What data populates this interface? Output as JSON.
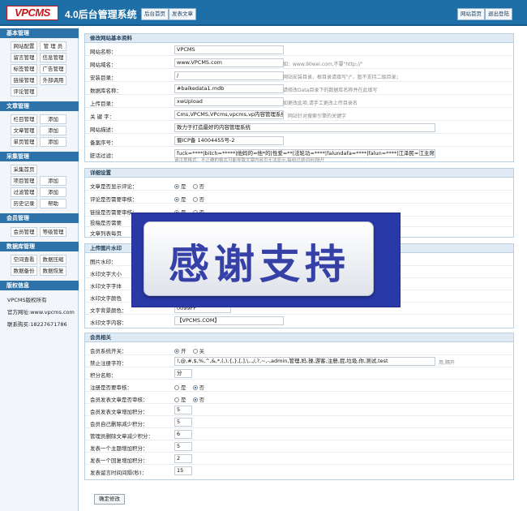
{
  "header": {
    "logo": "VPCMS",
    "title": "4.0后台管理系统",
    "btn_home": "后台首页",
    "btn_post": "发表文章",
    "btn_site_home": "网站首页",
    "btn_logout": "退出登陆"
  },
  "sidebar": {
    "basic": {
      "title": "基本管理",
      "items": [
        "网站配置",
        "管 理 员",
        "留言管理",
        "信息管理",
        "标签管理",
        "广告管理",
        "链接管理",
        "外部调用",
        "评论管理"
      ]
    },
    "article": {
      "title": "文章管理",
      "items": [
        "栏目管理",
        "添加",
        "文章管理",
        "添加",
        "单页管理",
        "添加"
      ]
    },
    "collect": {
      "title": "采集管理",
      "items": [
        "采集首页",
        "项目管理",
        "添加",
        "过滤管理",
        "添加",
        "历史记录",
        "帮助"
      ]
    },
    "member": {
      "title": "会员管理",
      "items": [
        "会员管理",
        "等级管理"
      ]
    },
    "database": {
      "title": "数据库管理",
      "items": [
        "空间查看",
        "数据压缩",
        "数据备份",
        "数据恢复"
      ]
    },
    "copyright": {
      "title": "版权信息",
      "lines": [
        "VPCMS版权所有",
        "官方网址:www.vpcms.com",
        "联系购买:18227671786"
      ]
    }
  },
  "basic_info": {
    "title": "修改网站基本资料",
    "rows": [
      {
        "label": "网站名称：",
        "value": "VPCMS",
        "hint": ""
      },
      {
        "label": "网站域名：",
        "value": "www.VPCMS.com",
        "hint": "如：www.90wei.com,不要\"http://\""
      },
      {
        "label": "安装目录：",
        "value": "/",
        "hint": "网站安装目录，根目录请填写\"/\"，暂不支持二级目录；"
      },
      {
        "label": "数据库名称：",
        "value": "#baikedata1.mdb",
        "hint": "请修改Data目录下的数据库名称并在此填写"
      },
      {
        "label": "上传目录：",
        "value": "xwUpload",
        "hint": "如更改此项,请手工更改上传目录名"
      },
      {
        "label": "关 键 字：",
        "value": "Cms,VPCMS,VPcms,vpcms,vp内容管理系统,最",
        "hint": "网站针对搜索引擎的关键字"
      },
      {
        "label": "网站描述：",
        "value": "致力于打造最好的内容管理系统",
        "hint": ""
      },
      {
        "label": "备案序号：",
        "value": "蜀ICP备 14004455号-2",
        "hint": ""
      },
      {
        "label": "脏话过滤：",
        "value": "fuck=****|bitch=*****|他妈的=他*的|性爱=**|法轮功=****|falundafa=****|falun=****|江泽民=江主席|操你妈=操*",
        "hint": "请注意格式：不正确的格式可能导致文章内容页无法显示,每组过滤词用|隔开"
      }
    ]
  },
  "detail": {
    "title": "详细设置",
    "rows": [
      {
        "label": "文章是否显示评论：",
        "opt1": "是",
        "opt2": "否"
      },
      {
        "label": "评论是否需要审核：",
        "opt1": "是",
        "opt2": "否"
      },
      {
        "label": "链接是否需要审核：",
        "opt1": "是",
        "opt2": "否"
      },
      {
        "label": "投稿是否需要",
        "opt1": "",
        "opt2": ""
      },
      {
        "label": "文章列表每页",
        "opt1": "",
        "opt2": ""
      }
    ]
  },
  "watermark": {
    "title": "上传图片水印",
    "rows": [
      {
        "label": "图片水印：",
        "value": ""
      },
      {
        "label": "水印文字大小",
        "value": ""
      },
      {
        "label": "水印文字字体",
        "value": ""
      },
      {
        "label": "水印文字颜色",
        "value": ""
      },
      {
        "label": "文字背景颜色：",
        "value": "0099FF"
      },
      {
        "label": "水印文字内容：",
        "value": "【VPCMS.COM】"
      }
    ]
  },
  "member": {
    "title": "会员相关",
    "rows": [
      {
        "label": "会员系统开关：",
        "type": "radio",
        "opt1": "开",
        "opt2": "关",
        "on": 1
      },
      {
        "label": "禁止注册字符：",
        "type": "text",
        "value": "!,@,#,$,%,^,&,*,(,),{,},[,],\\,.,/,?,~,-,admin,管理,妈,操,游客,注册,屁,垃圾,你,测试,test",
        "hint": "用,隔开"
      },
      {
        "label": "积分名称：",
        "type": "text",
        "value": "分"
      },
      {
        "label": "注册是否要审核：",
        "type": "radio",
        "opt1": "是",
        "opt2": "否",
        "on": 2
      },
      {
        "label": "会员发表文章是否审核：",
        "type": "radio",
        "opt1": "是",
        "opt2": "否",
        "on": 2
      },
      {
        "label": "会员发表文章增加积分：",
        "type": "text",
        "value": "5"
      },
      {
        "label": "会员自己删除减少积分：",
        "type": "text",
        "value": "5"
      },
      {
        "label": "管理员删除文章减少积分：",
        "type": "text",
        "value": "6"
      },
      {
        "label": "发表一个主题增加积分：",
        "type": "text",
        "value": "5"
      },
      {
        "label": "发表一个回复增加积分：",
        "type": "text",
        "value": "2"
      },
      {
        "label": "发表留言时间间隔(秒)：",
        "type": "text",
        "value": "15"
      }
    ]
  },
  "submit_label": "确定修改",
  "overlay_text": "感谢支持"
}
